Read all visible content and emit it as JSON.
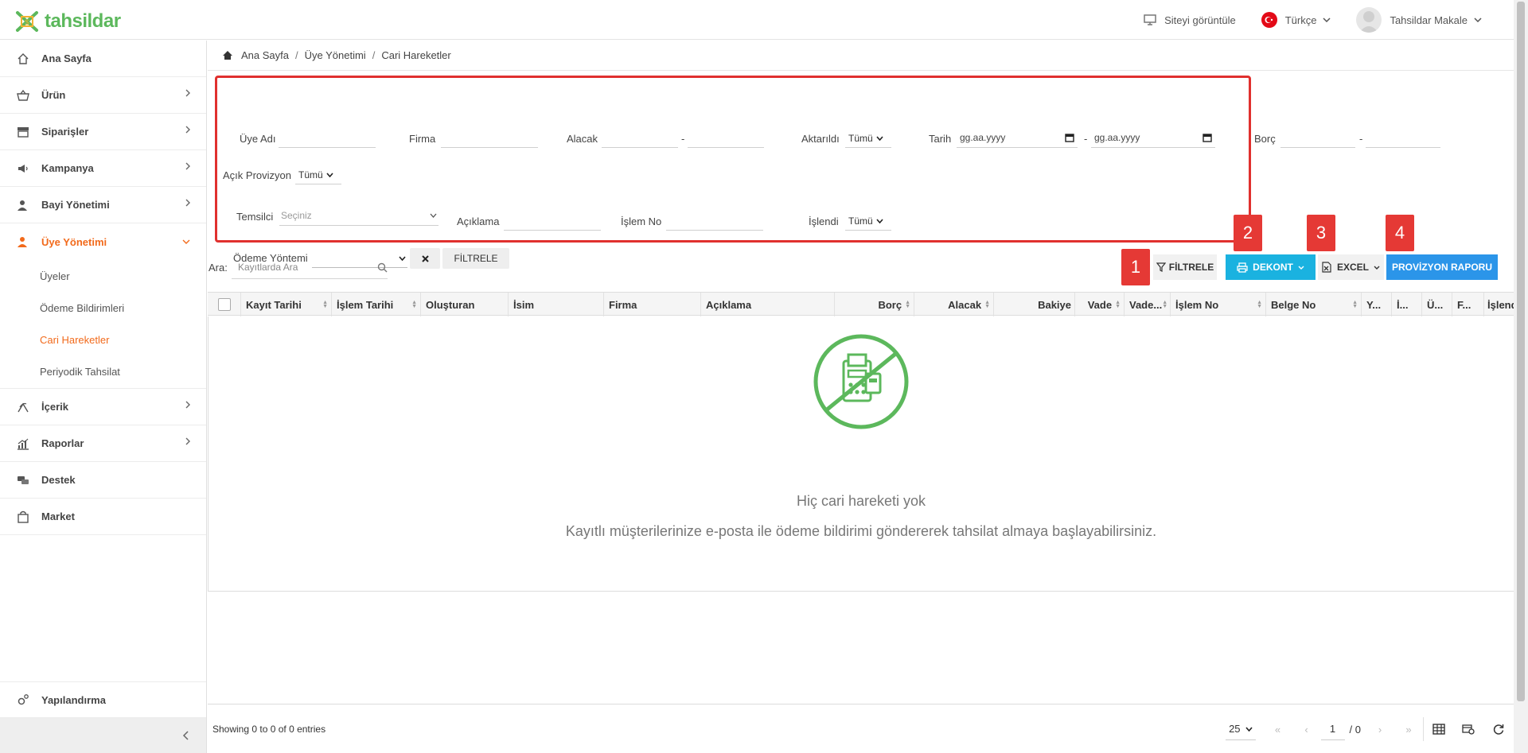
{
  "brand": {
    "name": "tahsildar",
    "color": "#5cb85c"
  },
  "topbar": {
    "view_site": "Siteyi görüntüle",
    "language": "Türkçe",
    "user": "Tahsildar Makale"
  },
  "sidebar": {
    "items": [
      {
        "label": "Ana Sayfa",
        "icon": "home-icon"
      },
      {
        "label": "Ürün",
        "icon": "basket-icon"
      },
      {
        "label": "Siparişler",
        "icon": "store-icon"
      },
      {
        "label": "Kampanya",
        "icon": "megaphone-icon"
      },
      {
        "label": "Bayi Yönetimi",
        "icon": "dealer-icon"
      },
      {
        "label": "Üye Yönetimi",
        "icon": "users-icon"
      }
    ],
    "sub_items": [
      "Üyeler",
      "Ödeme Bildirimleri",
      "Cari Hareketler",
      "Periyodik Tahsilat"
    ],
    "items_after": [
      {
        "label": "İçerik",
        "icon": "content-icon"
      },
      {
        "label": "Raporlar",
        "icon": "chart-icon"
      },
      {
        "label": "Destek",
        "icon": "support-icon"
      },
      {
        "label": "Market",
        "icon": "market-icon"
      }
    ],
    "config": "Yapılandırma"
  },
  "breadcrumb": {
    "home": "Ana Sayfa",
    "level1": "Üye Yönetimi",
    "level2": "Cari Hareketler"
  },
  "filters": {
    "member_name": "Üye Adı",
    "company": "Firma",
    "credit": "Alacak",
    "exported": "Aktarıldı",
    "exported_value": "Tümü",
    "date": "Tarih",
    "date_placeholder": "gg.aa.yyyy",
    "debt": "Borç",
    "open_provision": "Açık Provizyon",
    "open_provision_value": "Tümü",
    "representative": "Temsilci",
    "representative_placeholder": "Seçiniz",
    "description": "Açıklama",
    "transaction_no": "İşlem No",
    "processed": "İşlendi",
    "processed_value": "Tümü",
    "payment_method": "Ödeme Yöntemi",
    "filter_button": "FİLTRELE",
    "dash": "-"
  },
  "toolbar": {
    "search_label": "Ara:",
    "search_placeholder": "Kayıtlarda Ara",
    "filter": "FİLTRELE",
    "receipt": "DEKONT",
    "excel": "EXCEL",
    "provision_report": "PROVİZYON RAPORU",
    "badges": [
      "1",
      "2",
      "3",
      "4"
    ],
    "receipt_color": "#1ab2e0",
    "report_color": "#2b95e9"
  },
  "table": {
    "columns": [
      "Kayıt Tarihi",
      "İşlem Tarihi",
      "Oluşturan",
      "İsim",
      "Firma",
      "Açıklama",
      "Borç",
      "Alacak",
      "Bakiye",
      "Vade",
      "Vade...",
      "İşlem No",
      "Belge No",
      "Y...",
      "İ...",
      "Ü...",
      "F...",
      "İşlendi"
    ],
    "empty_title": "Hiç cari hareketi yok",
    "empty_subtitle": "Kayıtlı müşterilerinize e-posta ile ödeme bildirimi göndererek tahsilat almaya başlayabilirsiniz."
  },
  "footer": {
    "showing": "Showing 0 to 0 of 0 entries",
    "page_size": "25",
    "page": "1",
    "page_total": "/ 0"
  }
}
